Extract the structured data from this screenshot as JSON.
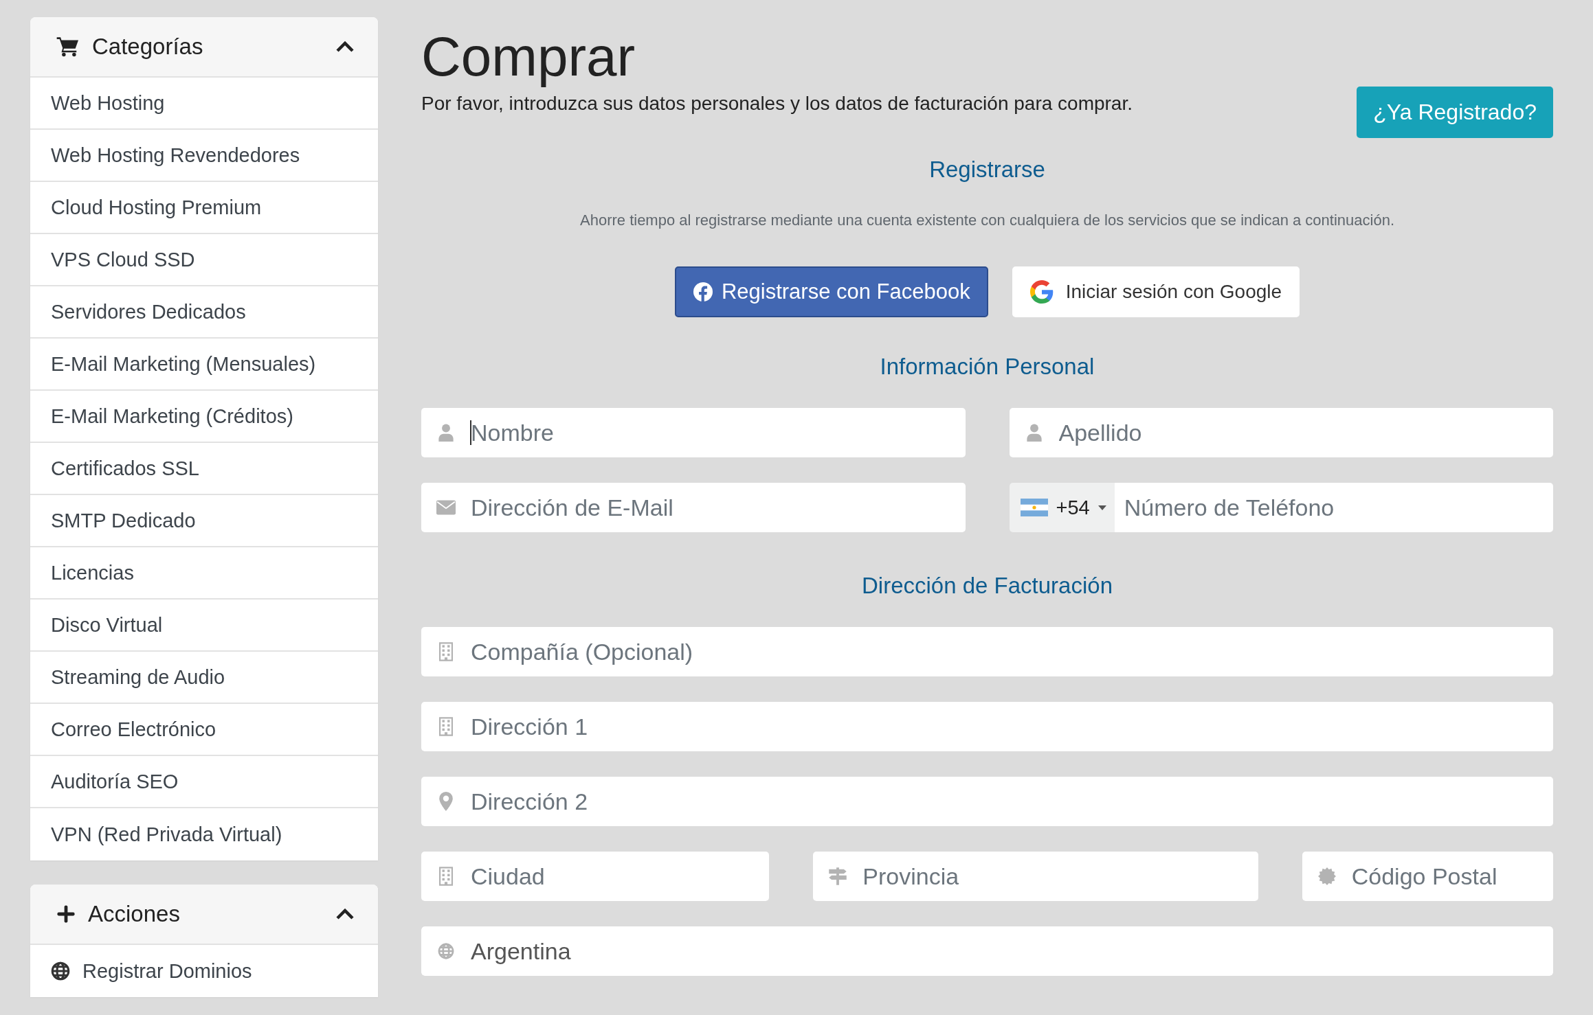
{
  "sidebar": [
    {
      "title": "Categorías",
      "expanded": true,
      "items": [
        {
          "label": "Web Hosting"
        },
        {
          "label": "Web Hosting Revendedores"
        },
        {
          "label": "Cloud Hosting Premium"
        },
        {
          "label": "VPS Cloud SSD"
        },
        {
          "label": "Servidores Dedicados"
        },
        {
          "label": "E-Mail Marketing (Mensuales)"
        },
        {
          "label": "E-Mail Marketing (Créditos)"
        },
        {
          "label": "Certificados SSL"
        },
        {
          "label": "SMTP Dedicado"
        },
        {
          "label": "Licencias"
        },
        {
          "label": "Disco Virtual"
        },
        {
          "label": "Streaming de Audio"
        },
        {
          "label": "Correo Electrónico"
        },
        {
          "label": "Auditoría SEO"
        },
        {
          "label": "VPN (Red Privada Virtual)"
        }
      ]
    },
    {
      "title": "Acciones",
      "expanded": true,
      "items": [
        {
          "label": "Registrar Dominios"
        }
      ]
    }
  ],
  "page": {
    "title": "Comprar",
    "intro": "Por favor, introduzca sus datos personales y los datos de facturación para comprar.",
    "login_button": "¿Ya Registrado?"
  },
  "signup": {
    "heading": "Registrarse",
    "note": "Ahorre tiempo al registrarse mediante una cuenta existente con cualquiera de los servicios que se indican a continuación.",
    "buttons": [
      {
        "kind": "facebook",
        "label": "Registrarse con Facebook"
      },
      {
        "kind": "google",
        "label": "Iniciar sesión con Google"
      }
    ]
  },
  "personal": {
    "heading": "Información Personal",
    "rows": [
      [
        {
          "kind": "person",
          "placeholder": "Nombre",
          "focused": true
        },
        {
          "kind": "person",
          "placeholder": "Apellido",
          "focused": false
        }
      ],
      [
        {
          "kind": "email",
          "placeholder": "Dirección de E-Mail",
          "focused": false
        },
        {
          "kind": "phone",
          "country_code": "+54",
          "placeholder": "Número de Teléfono",
          "focused": false
        }
      ]
    ]
  },
  "billing": {
    "heading": "Dirección de Facturación",
    "rows": [
      [
        {
          "kind": "company",
          "placeholder": "Compañía (Opcional)",
          "focused": false
        }
      ],
      [
        {
          "kind": "address",
          "placeholder": "Dirección 1",
          "focused": false
        }
      ],
      [
        {
          "kind": "location",
          "placeholder": "Dirección 2",
          "focused": false
        }
      ],
      [
        {
          "kind": "city",
          "placeholder": "Ciudad",
          "focused": false
        },
        {
          "kind": "state",
          "placeholder": "Provincia",
          "focused": false
        },
        {
          "kind": "postcode",
          "placeholder": "Código Postal",
          "focused": false
        }
      ],
      [
        {
          "kind": "country",
          "value": "Argentina"
        }
      ]
    ]
  }
}
